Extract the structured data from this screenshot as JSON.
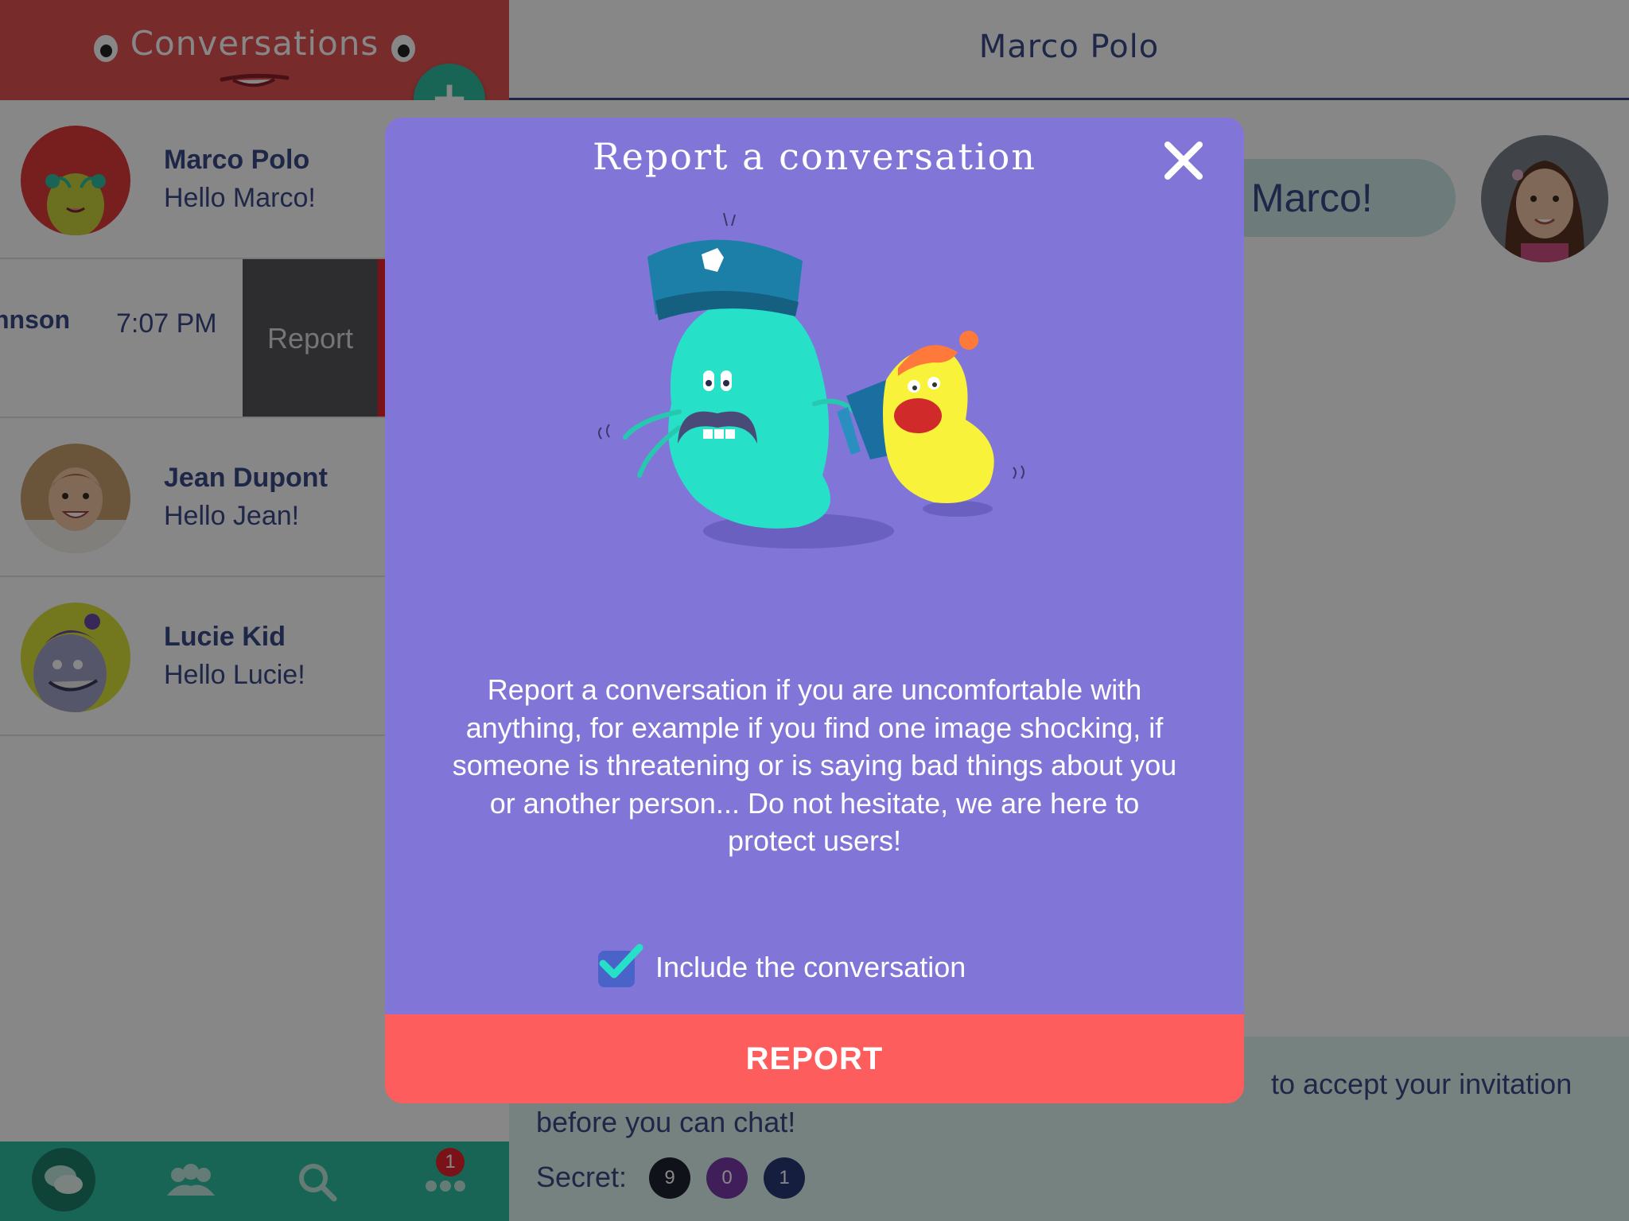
{
  "left_panel": {
    "title": "Conversations",
    "add_button": "+",
    "conversations": [
      {
        "name": "Marco Polo",
        "message": "Hello Marco!"
      },
      {
        "name": "Jean Dupont",
        "message": "Hello Jean!"
      },
      {
        "name": "Lucie Kid",
        "message": "Hello Lucie!"
      }
    ],
    "swiped_row": {
      "name_partial": "nnson",
      "time": "7:07 PM",
      "action_label": "Report"
    },
    "bottom_nav": {
      "items": [
        "chat-icon",
        "friends-icon",
        "search-icon",
        "more-icon"
      ],
      "badge_count": "1"
    }
  },
  "right_panel": {
    "title": "Marco Polo",
    "bubble_text": "Hello Marco!",
    "invite_text": "… to accept your invitation before you can chat!",
    "invite_text_visible_tail": "to accept your invitation",
    "invite_text_line2": "before you can chat!",
    "secret_label": "Secret:",
    "secret_digits": [
      "9",
      "0",
      "1"
    ],
    "secret_colors": [
      "#1f2230",
      "#7a3aa8",
      "#2b3a7a"
    ]
  },
  "modal": {
    "title": "Report a conversation",
    "close_icon": "close-icon",
    "illustration": "police-monster-megaphone-illustration",
    "body": "Report a conversation if you are uncomfortable with anything, for example if you find one image shocking, if someone is threatening or is saying bad things about you or another person... Do not hesitate, we are here to protect users!",
    "include_label": "Include the conversation",
    "include_checked": true,
    "report_button": "REPORT"
  },
  "colors": {
    "header_red": "#e05252",
    "teal": "#2fbfa0",
    "navy": "#3c4a8a",
    "modal_purple": "#8176d8",
    "report_red": "#fe5d5d"
  }
}
